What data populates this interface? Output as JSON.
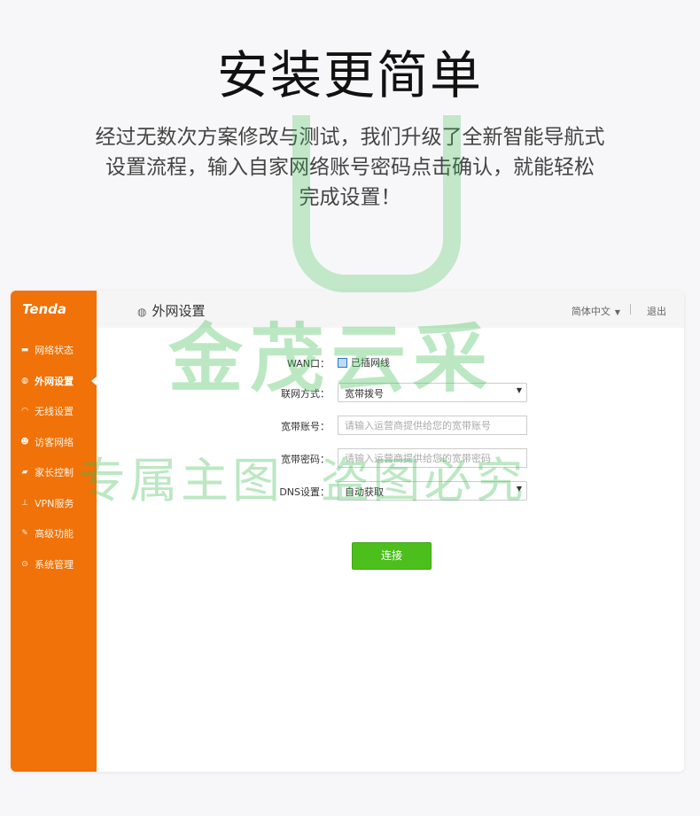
{
  "headline": "安装更简单",
  "intro": [
    "经过无数次方案修改与测试，我们升级了全新智能导航式",
    "设置流程，输入自家网络账号密码点击确认，就能轻松",
    "完成设置！"
  ],
  "router": {
    "logo": "Tenda",
    "nav": [
      {
        "label": "网络状态",
        "icon": "status-icon"
      },
      {
        "label": "外网设置",
        "icon": "globe-icon",
        "active": true
      },
      {
        "label": "无线设置",
        "icon": "wifi-icon"
      },
      {
        "label": "访客网络",
        "icon": "guest-icon"
      },
      {
        "label": "家长控制",
        "icon": "parental-icon"
      },
      {
        "label": "VPN服务",
        "icon": "vpn-icon"
      },
      {
        "label": "高级功能",
        "icon": "tools-icon"
      },
      {
        "label": "系统管理",
        "icon": "settings-icon"
      }
    ],
    "page_title": "外网设置",
    "language": "简体中文",
    "logout": "退出",
    "form": {
      "wan_label": "WAN口：",
      "wan_status": "已插网线",
      "mode_label": "联网方式：",
      "mode_value": "宽带拨号",
      "account_label": "宽带账号：",
      "account_placeholder": "请输入运营商提供给您的宽带账号",
      "password_label": "宽带密码：",
      "password_placeholder": "请输入运营商提供给您的宽带密码",
      "dns_label": "DNS设置：",
      "dns_value": "自动获取",
      "connect_label": "连接"
    }
  },
  "watermark": {
    "main": "金茂云采",
    "sub": "专属主图  盗图必究"
  },
  "colors": {
    "sidebar": "#f07208",
    "button": "#4cbf1c",
    "watermark": "#3cbe50"
  }
}
